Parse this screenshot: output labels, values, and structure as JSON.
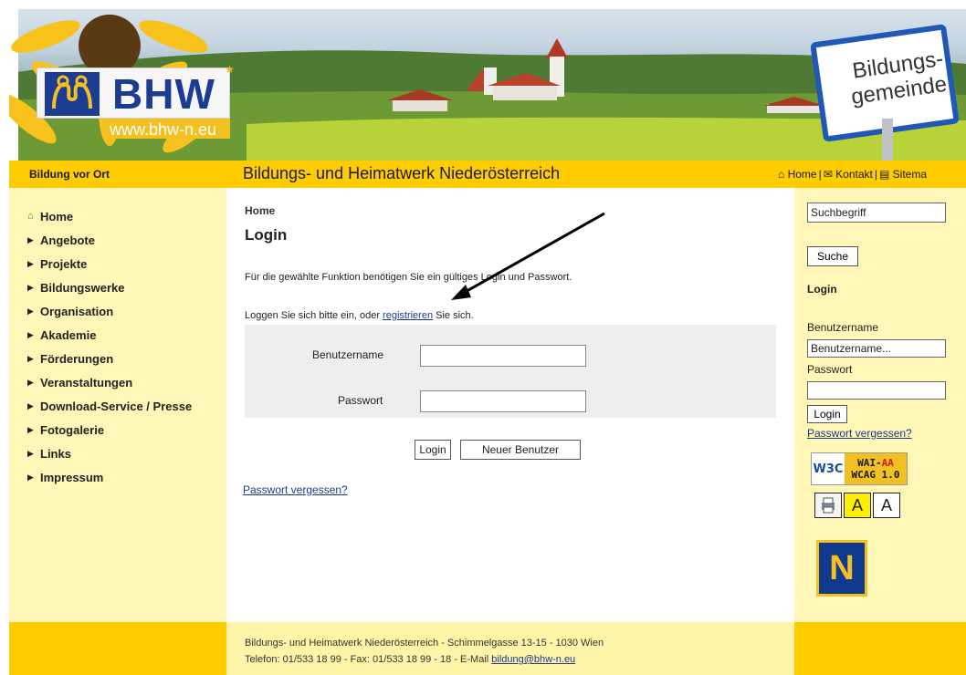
{
  "banner": {
    "logo_text": "BHW",
    "logo_url": "www.bhw-n.eu",
    "sign_text": "Bildungs-\ngemeinde"
  },
  "header": {
    "tagline": "Bildung vor Ort",
    "site_title": "Bildungs- und Heimatwerk Niederösterreich",
    "links": {
      "home": "Home",
      "kontakt": "Kontakt",
      "sitemap": "Sitema"
    }
  },
  "leftnav": {
    "items": [
      {
        "label": "Home",
        "icon": "home-icon"
      },
      {
        "label": "Angebote",
        "icon": "triangle-right-icon"
      },
      {
        "label": "Projekte",
        "icon": "triangle-right-icon"
      },
      {
        "label": "Bildungswerke",
        "icon": "triangle-right-icon"
      },
      {
        "label": "Organisation",
        "icon": "triangle-right-icon"
      },
      {
        "label": "Akademie",
        "icon": "triangle-right-icon"
      },
      {
        "label": "Förderungen",
        "icon": "triangle-right-icon"
      },
      {
        "label": "Veranstaltungen",
        "icon": "triangle-right-icon"
      },
      {
        "label": "Download-Service / Presse",
        "icon": "triangle-right-icon"
      },
      {
        "label": "Fotogalerie",
        "icon": "triangle-right-icon"
      },
      {
        "label": "Links",
        "icon": "triangle-right-icon"
      },
      {
        "label": "Impressum",
        "icon": "triangle-right-icon"
      }
    ]
  },
  "main": {
    "breadcrumb": "Home",
    "heading": "Login",
    "info1": "Für die gewählte Funktion benötigen Sie ein gültiges Login und Passwort.",
    "info2_before": "Loggen Sie sich bitte ein, oder ",
    "info2_link": "registrieren",
    "info2_after": " Sie sich.",
    "username_label": "Benutzername",
    "password_label": "Passwort",
    "username_value": "",
    "password_value": "",
    "login_button": "Login",
    "new_user_button": "Neuer Benutzer",
    "forgot_link": "Passwort vergessen?"
  },
  "rightbar": {
    "search_value": "Suchbegriff",
    "search_button": "Suche",
    "heading": "Login",
    "username_label": "Benutzername",
    "username_value": "Benutzername...",
    "password_label": "Passwort",
    "login_button": "Login",
    "forgot_link": "Passwort vergessen?",
    "w3c_left": "W3C",
    "w3c_wai": "WAI-",
    "w3c_aa": "AA",
    "w3c_wcag": "WCAG 1.0",
    "font_a1": "A",
    "font_a2": "A",
    "n_logo": "N"
  },
  "footer": {
    "line1": "Bildungs- und Heimatwerk Niederösterreich - Schimmelgasse 13-15 - 1030 Wien",
    "line2_before": "Telefon: 01/533 18 99 - Fax: 01/533 18 99 - 18 - E-Mail ",
    "email": "bildung@bhw-n.eu"
  },
  "colors": {
    "yellow": "#ffcc00",
    "pale_yellow": "#fff7b8",
    "link_blue": "#1a3a8a",
    "logo_blue": "#1c3b92"
  }
}
